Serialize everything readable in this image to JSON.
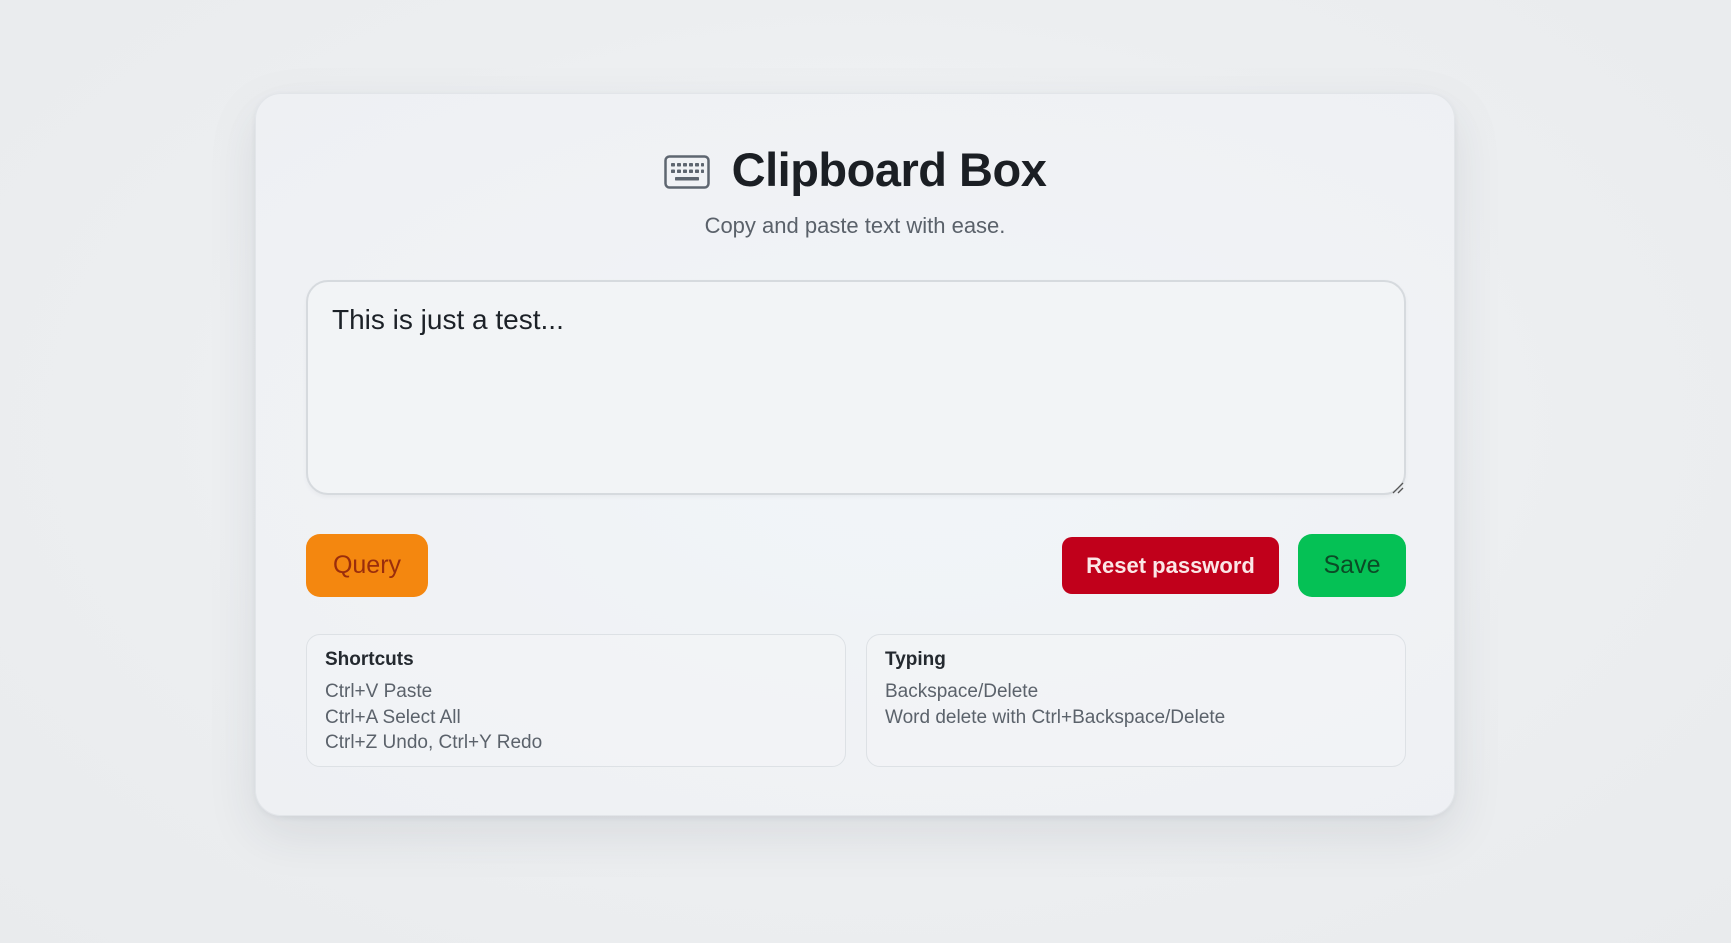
{
  "app": {
    "title": "Clipboard Box",
    "subtitle": "Copy and paste text with ease.",
    "title_icon": "keyboard-icon"
  },
  "editor": {
    "value": "This is just a test..."
  },
  "actions": {
    "query_label": "Query",
    "reset_label": "Reset password",
    "save_label": "Save"
  },
  "colors": {
    "query": "#f4870f",
    "reset": "#c1001b",
    "save": "#05c155"
  },
  "panels": {
    "shortcuts": {
      "title": "Shortcuts",
      "lines": [
        "Ctrl+V Paste",
        "Ctrl+A Select All",
        "Ctrl+Z Undo, Ctrl+Y Redo"
      ]
    },
    "typing": {
      "title": "Typing",
      "lines": [
        "Backspace/Delete",
        "Word delete with Ctrl+Backspace/Delete"
      ]
    }
  }
}
